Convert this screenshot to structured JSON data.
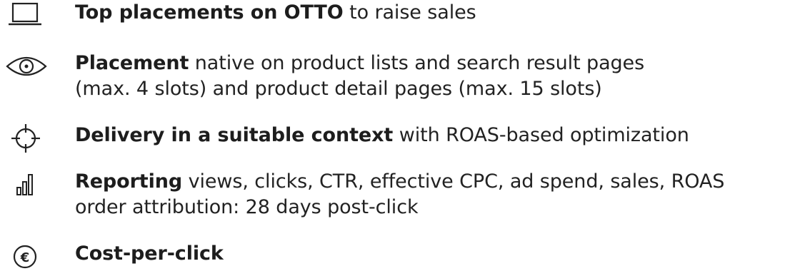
{
  "features": [
    {
      "icon": "laptop-icon",
      "title": "Top placements on OTTO",
      "lines": [
        " to raise sales"
      ]
    },
    {
      "icon": "eye-icon",
      "title": "Placement",
      "lines": [
        " native on product lists and search result pages",
        "(max. 4 slots) and product detail pages (max. 15 slots)"
      ]
    },
    {
      "icon": "crosshair-icon",
      "title": "Delivery in a suitable context",
      "lines": [
        " with ROAS-based optimization"
      ]
    },
    {
      "icon": "bar-chart-icon",
      "title": "Reporting",
      "lines": [
        " views, clicks, CTR, effective CPC, ad spend, sales, ROAS",
        "order attribution: 28 days post-click"
      ]
    },
    {
      "icon": "euro-icon",
      "title": "Cost-per-click",
      "lines": [
        ""
      ]
    }
  ]
}
